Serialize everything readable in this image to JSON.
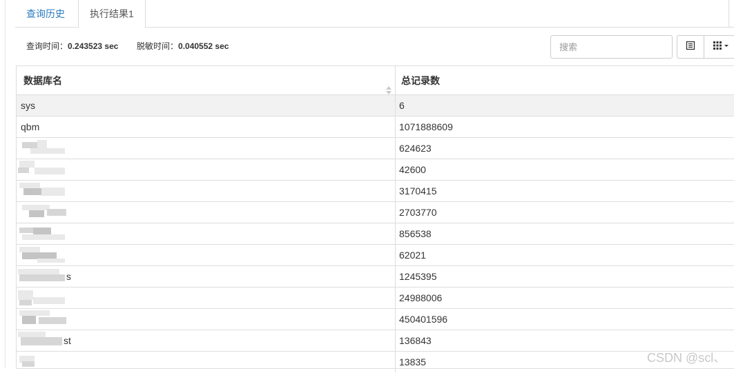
{
  "tabs": [
    {
      "label": "查询历史",
      "active": false
    },
    {
      "label": "执行结果1",
      "active": true
    }
  ],
  "timing": {
    "query_label": "查询时间：",
    "query_value": "0.243523 sec",
    "mask_label": "脱敏时间：",
    "mask_value": "0.040552 sec"
  },
  "toolbar": {
    "search_placeholder": "搜索",
    "list_view_icon": "list-icon",
    "columns_icon": "grid-columns-icon"
  },
  "table": {
    "columns": [
      "数据库名",
      "总记录数"
    ],
    "rows": [
      {
        "name": "sys",
        "count": "6"
      },
      {
        "name": "qbm",
        "count": "1071888609"
      },
      {
        "name": "",
        "count": "624623"
      },
      {
        "name": "",
        "count": "42600"
      },
      {
        "name": "",
        "count": "3170415"
      },
      {
        "name": "",
        "count": "2703770"
      },
      {
        "name": "",
        "count": "856538"
      },
      {
        "name": "",
        "count": "62021"
      },
      {
        "name": "s",
        "count": "1245395"
      },
      {
        "name": "",
        "count": "24988006"
      },
      {
        "name": "",
        "count": "450401596"
      },
      {
        "name": "st",
        "count": "136843"
      },
      {
        "name": "",
        "count": "13835"
      }
    ]
  },
  "watermark": "CSDN @scl、",
  "colors": {
    "link": "#2b7bc0",
    "border": "#dddddd",
    "stripe": "#f2f2f2"
  }
}
